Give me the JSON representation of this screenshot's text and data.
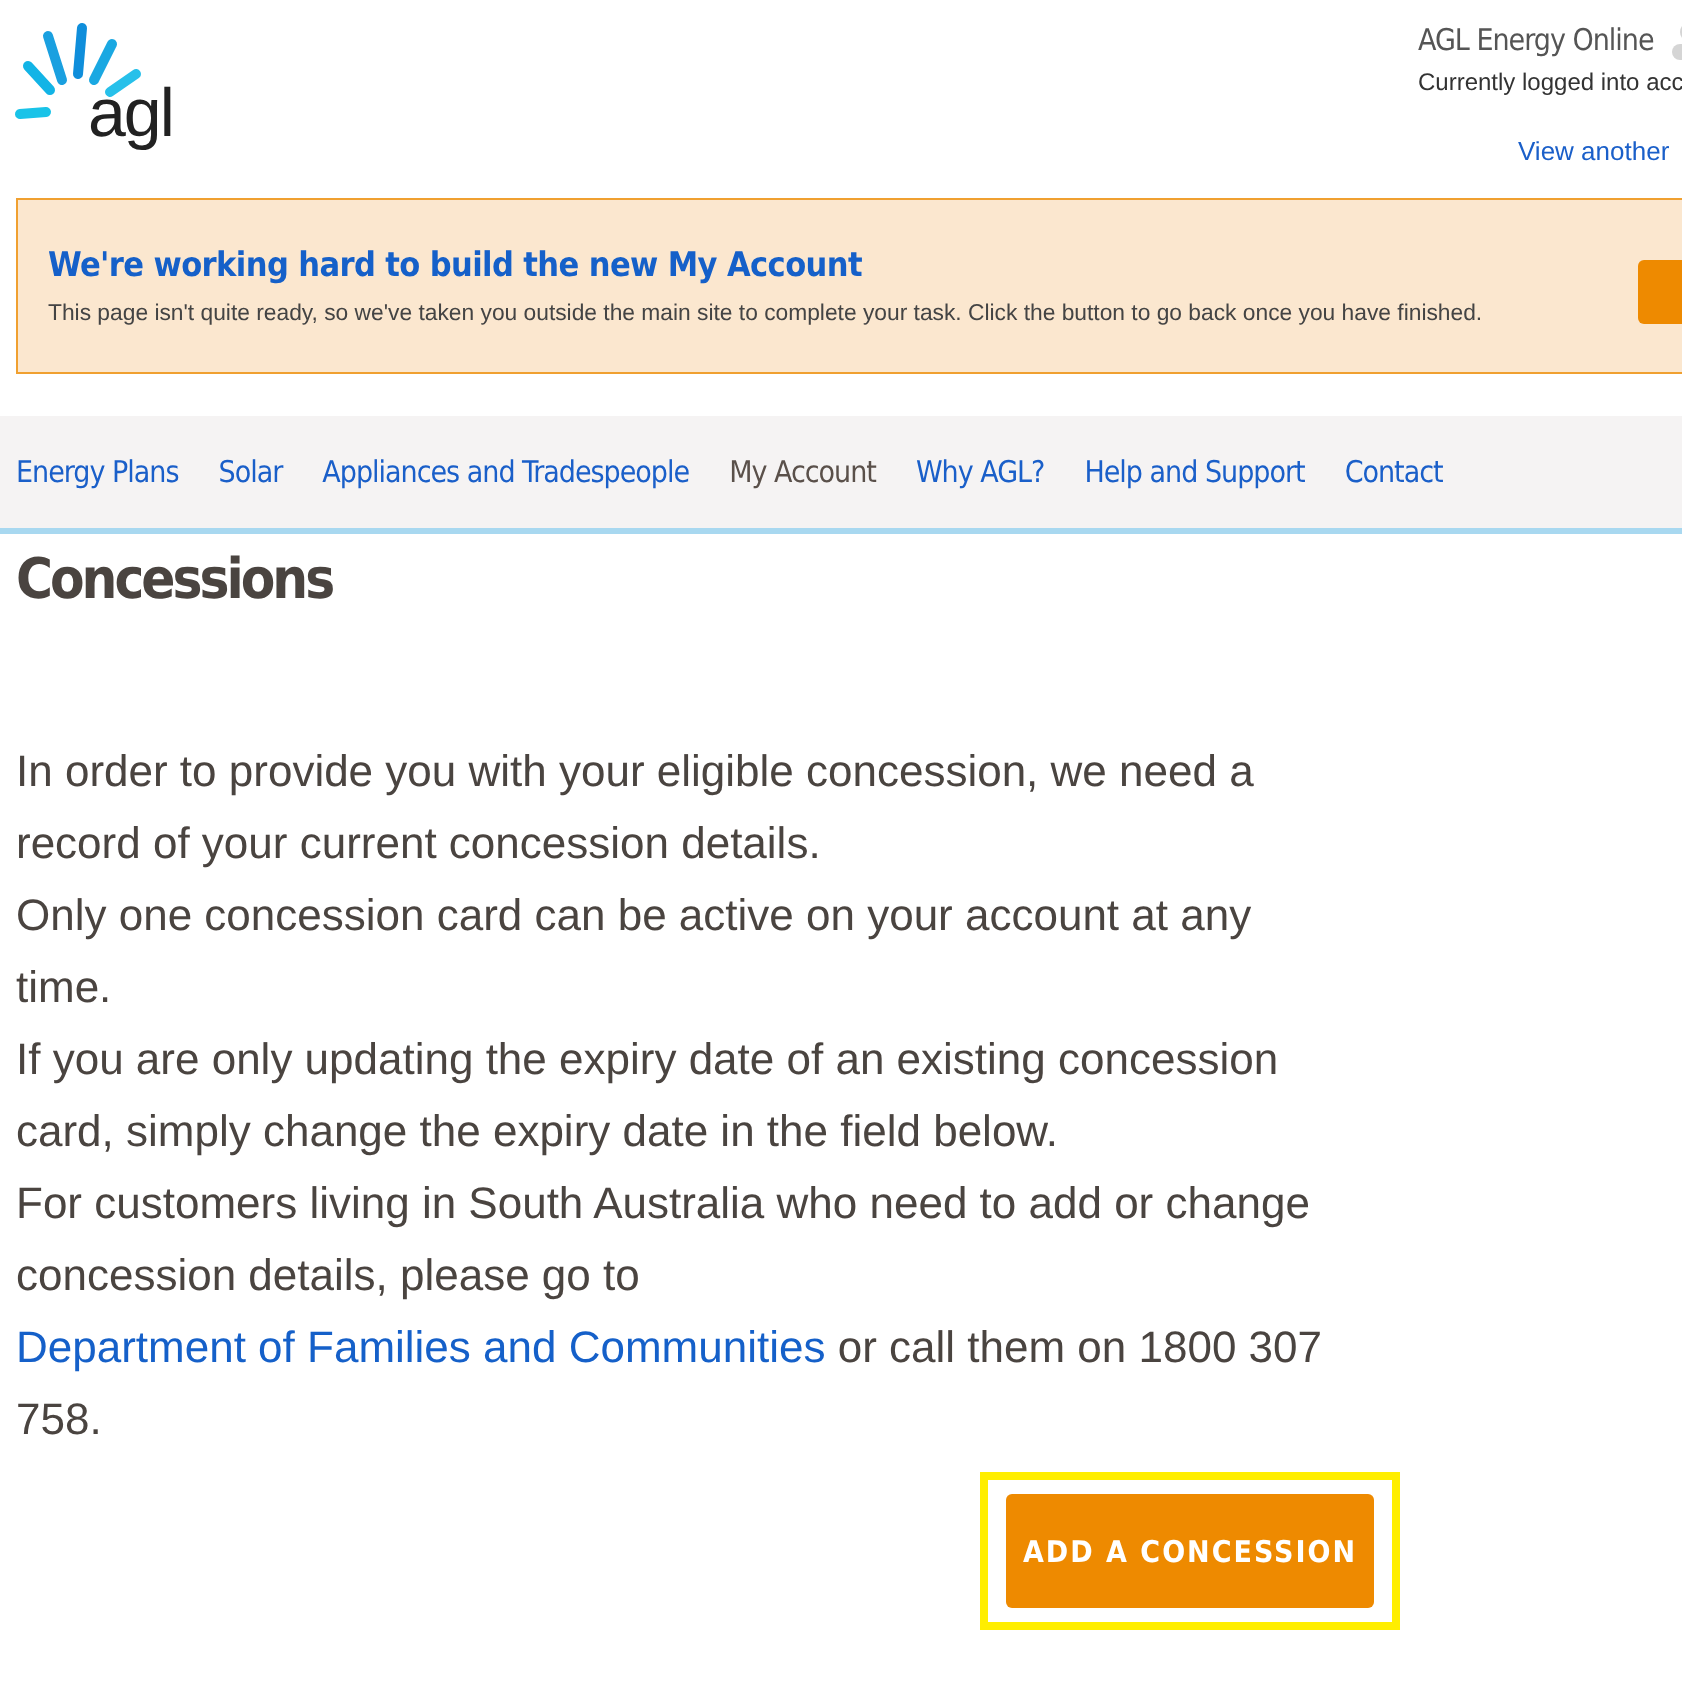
{
  "header": {
    "logo_text": "agl",
    "site_title": "AGL Energy Online",
    "account_status": "Currently logged into acc",
    "account_link": "View another"
  },
  "banner": {
    "title": "We're working hard to build the new My Account",
    "message": "This page isn't quite ready, so we've taken you outside the main site to complete your task. Click the button to go back once you have finished."
  },
  "nav": [
    {
      "label": "Energy Plans",
      "selected": false
    },
    {
      "label": "Solar",
      "selected": false
    },
    {
      "label": "Appliances and Tradespeople",
      "selected": false
    },
    {
      "label": "My Account",
      "selected": true
    },
    {
      "label": "Why AGL?",
      "selected": false
    },
    {
      "label": "Help and Support",
      "selected": false
    },
    {
      "label": "Contact",
      "selected": false
    }
  ],
  "page_title": "Concessions",
  "intro": [
    {
      "text": "In order to provide you with your eligible concession, we need a record of your current concession details."
    },
    {
      "text": "Only one concession card can be active on your account at any time."
    },
    {
      "text": "If you are only updating the expiry date of an existing concession card, simply change the expiry date in the field below."
    },
    {
      "text": "For customers living in South Australia who need to add or change concession details, please go to",
      "link": "Department of Families and Communities",
      "after": "or call them on 1800 307 758."
    }
  ],
  "add_button": {
    "label": "ADD A CONCESSION",
    "highlighted": true
  }
}
